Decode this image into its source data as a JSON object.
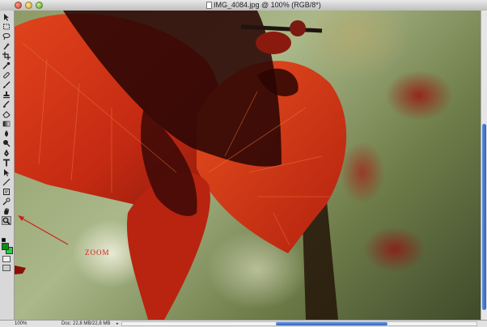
{
  "window": {
    "title": "IMG_4084.jpg @ 100% (RGB/8*)"
  },
  "tools": [
    {
      "name": "move-tool"
    },
    {
      "name": "marquee-tool"
    },
    {
      "name": "lasso-tool"
    },
    {
      "name": "magic-wand-tool"
    },
    {
      "name": "crop-tool"
    },
    {
      "name": "eyedropper-tool"
    },
    {
      "name": "healing-brush-tool"
    },
    {
      "name": "brush-tool"
    },
    {
      "name": "clone-stamp-tool"
    },
    {
      "name": "history-brush-tool"
    },
    {
      "name": "eraser-tool"
    },
    {
      "name": "gradient-tool"
    },
    {
      "name": "blur-tool"
    },
    {
      "name": "dodge-tool"
    },
    {
      "name": "pen-tool"
    },
    {
      "name": "type-tool"
    },
    {
      "name": "path-selection-tool"
    },
    {
      "name": "line-tool"
    },
    {
      "name": "notes-tool"
    },
    {
      "name": "eyedropper-sample-tool"
    },
    {
      "name": "hand-tool"
    },
    {
      "name": "zoom-tool",
      "active": true
    }
  ],
  "colors": {
    "foreground": "#0a8f12",
    "background": "#1fd33a",
    "annotation": "#d21f1f"
  },
  "annotation": {
    "label": "ZOOM"
  },
  "status": {
    "zoom": "100%",
    "doc_info": "Doc: 22,8 MB/22,8 MB"
  }
}
